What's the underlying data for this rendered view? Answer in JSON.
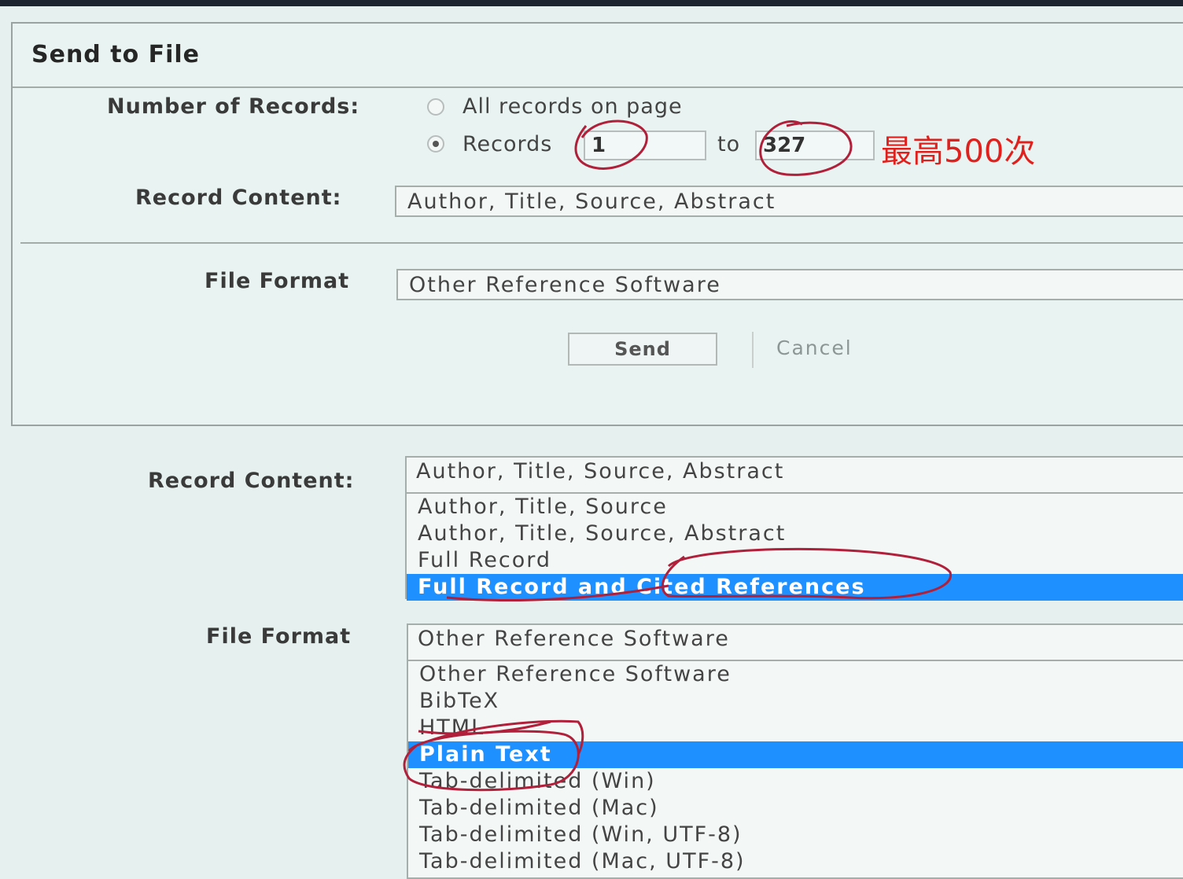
{
  "dialog": {
    "title": "Send to File",
    "number_of_records_label": "Number of Records:",
    "all_records_label": "All records on page",
    "records_label": "Records",
    "records_from": "1",
    "to_label": "to",
    "records_to": "327",
    "record_content_label": "Record Content:",
    "record_content_value": "Author, Title, Source, Abstract",
    "file_format_label": "File Format",
    "file_format_value": "Other Reference Software",
    "send_label": "Send",
    "cancel_label": "Cancel",
    "selected_radio": "records"
  },
  "annotation": {
    "note_text": "最高500次",
    "ink_color": "#b0203a",
    "note_color": "#e0201c"
  },
  "record_content_dropdown": {
    "label": "Record Content:",
    "current": "Author, Title, Source, Abstract",
    "options": [
      "Author, Title, Source",
      "Author, Title, Source, Abstract",
      "Full Record",
      "Full Record and Cited References"
    ],
    "selected": "Full Record and Cited References"
  },
  "file_format_dropdown": {
    "label": "File Format",
    "current": "Other Reference Software",
    "options": [
      "Other Reference Software",
      "BibTeX",
      "HTML",
      "Plain Text",
      "Tab-delimited (Win)",
      "Tab-delimited (Mac)",
      "Tab-delimited (Win, UTF-8)",
      "Tab-delimited (Mac, UTF-8)"
    ],
    "selected": "Plain Text"
  },
  "colors": {
    "selection": "#1e90ff",
    "background": "#e6f1ef"
  }
}
